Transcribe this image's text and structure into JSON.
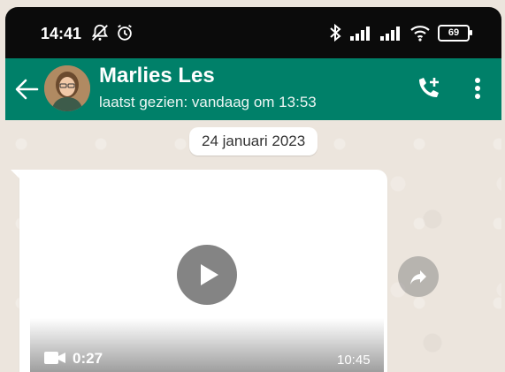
{
  "status_bar": {
    "time": "14:41",
    "battery": "69",
    "left_icons": [
      "notifications-muted-icon",
      "alarm-icon"
    ],
    "right_icons": [
      "bluetooth-icon",
      "signal-icon",
      "signal-icon",
      "wifi-icon",
      "battery-icon"
    ]
  },
  "header": {
    "contact_name": "Marlies Les",
    "last_seen": "laatst gezien: vandaag om 13:53",
    "icons": [
      "back-arrow-icon",
      "add-call-icon",
      "more-vert-icon"
    ]
  },
  "chat": {
    "date_chip": "24 januari 2023",
    "message": {
      "type": "video",
      "duration": "0:27",
      "time": "10:45"
    }
  },
  "colors": {
    "header_bg": "#008069",
    "chat_bg": "#ece5dd",
    "bubble_bg": "#ffffff",
    "status_bar_bg": "#0b0b0b"
  }
}
